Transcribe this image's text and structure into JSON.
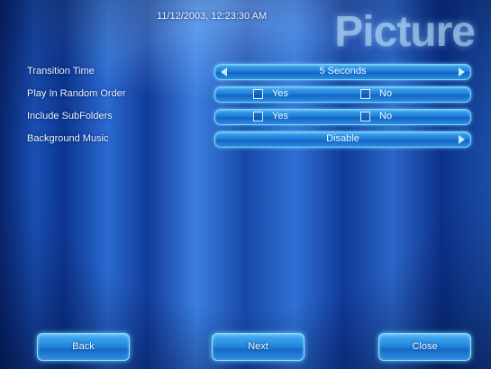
{
  "header": {
    "timestamp": "11/12/2003, 12:23:30 AM",
    "brand": "Picture"
  },
  "settings": [
    {
      "label": "Transition Time",
      "value": "5 Seconds"
    },
    {
      "label": "Play In Random Order",
      "yes_label": "Yes",
      "no_label": "No"
    },
    {
      "label": "Include SubFolders",
      "yes_label": "Yes",
      "no_label": "No"
    },
    {
      "label": "Background Music",
      "value": "Disable"
    }
  ],
  "buttons": {
    "back": "Back",
    "next": "Next",
    "close": "Close"
  },
  "colors": {
    "accent": "#6fd8ff",
    "background": "#1a52b8"
  }
}
